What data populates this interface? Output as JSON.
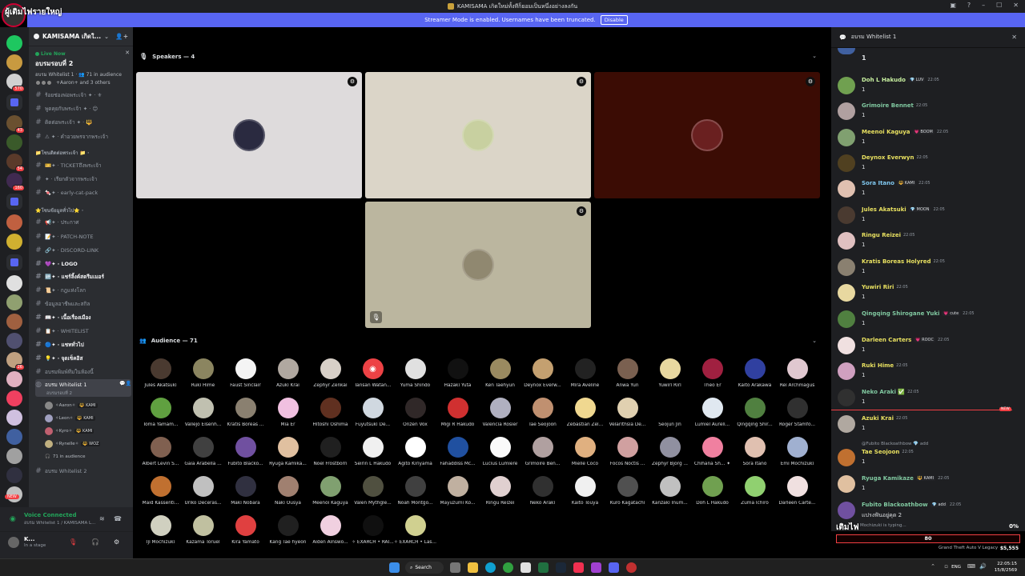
{
  "window": {
    "title": "KAMISAMA เกิดใหม่ทั้งทีก็ยอมเป็นหนึ่งอย่างลงกัน"
  },
  "overlay": {
    "title": "ผู้เติมไฟรายใหญ่",
    "bar_label": "เติมไฟ",
    "bar_percent": "0%",
    "bar_value": "80",
    "bar_fraction": 0.0
  },
  "streamer": {
    "text": "Streamer Mode is enabled. Usernames have been truncated.",
    "button": "Disable"
  },
  "server": {
    "name": "KAMISAMA เกิดใ...",
    "live_label": "Live Now",
    "stage_title": "อบรมรอบที่ 2",
    "stage_meta": "อบรม Whitelist 1 · 👥 71 in audience",
    "attendees": "+Aaron+ and 3 others"
  },
  "channels": [
    {
      "label": "ร้อยช่องพ่อพระเจ้า ✦ · ⚜",
      "kind": "channel"
    },
    {
      "label": "พูดคุยกับพระเจ้า ✦ · 😊",
      "kind": "channel"
    },
    {
      "label": "ติดต่อพระเจ้า ✦ · 🔱",
      "kind": "channel"
    },
    {
      "label": "⚠ ✦ · คำอวยพรจากพระเจ้า",
      "kind": "channel"
    },
    {
      "label": "📁โซนติดต่อพระเจ้า 📁 ·",
      "kind": "category"
    },
    {
      "label": "🎫✦ · TICKETถึงพระเจ้า",
      "kind": "channel"
    },
    {
      "label": "✦ · เรียกตัวจากพระเจ้า",
      "kind": "channel"
    },
    {
      "label": "🍬✦ · early-cat-pack",
      "kind": "channel"
    },
    {
      "label": "⭐โซนข้อมูลทั่วไป⭐ ·",
      "kind": "category"
    },
    {
      "label": "📢✦ · ประกาศ",
      "kind": "channel"
    },
    {
      "label": "📝✦ · PATCH-NOTE",
      "kind": "channel"
    },
    {
      "label": "🔗✦ · DISCORD-LINK",
      "kind": "channel"
    },
    {
      "label": "💜✦ · LOGO",
      "kind": "bold"
    },
    {
      "label": "🆙✦ · แชร์ลิ้งค์สตรีมเมอร์",
      "kind": "bold"
    },
    {
      "label": "📜✦ · กฎแห่งโลก",
      "kind": "channel"
    },
    {
      "label": "ข้อมูลอาชีพและสกิล",
      "kind": "channel"
    },
    {
      "label": "📖✦ · เนื้อเรื่องเมือง",
      "kind": "bold"
    },
    {
      "label": "📋✦ · WHITELIST",
      "kind": "channel"
    },
    {
      "label": "🔵✦ · แชททั่วไป",
      "kind": "bold"
    },
    {
      "label": "💡✦ · จุดเช็คอิส",
      "kind": "bold"
    },
    {
      "label": "อบรมพิมพ์ทีมในห้องนี้",
      "kind": "channel"
    },
    {
      "label": "อบรม Whitelist 1",
      "kind": "selected"
    },
    {
      "label": "อบรม Whitelist 2",
      "kind": "channel"
    }
  ],
  "selected_sub": "อบรมรอบที่ 2",
  "voice_users": [
    {
      "name": "✧Aaron✧",
      "tag": "KAMI"
    },
    {
      "name": "✧Leon✧",
      "tag": "KAMI"
    },
    {
      "name": "✧Kyro✧",
      "tag": "KAMI"
    },
    {
      "name": "✧Rynelle✧",
      "tag": "WOZ"
    }
  ],
  "voice_count": "71 in audience",
  "voice_panel": {
    "status": "Voice Connected",
    "channel": "อบรม Whitelist 1 / KAMISAMA L..."
  },
  "user": {
    "name": "K...",
    "status": "In a stage"
  },
  "new_pill": "NEW",
  "speakers": {
    "heading": "Speakers — 4"
  },
  "audience": {
    "heading": "Audience — 71",
    "names": [
      "Jules Akatsuki",
      "Ruki Hime",
      "Faust Sinclair",
      "Azuki Krai",
      "Zephyr Zenkai",
      "Tansan Watan...",
      "Yuma Shindo",
      "Hazaki Yuta",
      "Ken Taehyun",
      "Deynox Everw...",
      "Mira Aveline",
      "Anwa Yun",
      "Yuwiri Riri",
      "Theo Er",
      "Kaito Arakawa",
      "Rei Archmagus",
      "Toma Yamam...",
      "Vallejo Eisenh...",
      "Kratis Boreas ...",
      "Mia Er",
      "Hitoshi Oshima",
      "Fuyutsuki De...",
      "Onzen Vox",
      "Migi R Hakudo",
      "Valencia Rosier",
      "Tae Seojoon",
      "Zebastian Zel...",
      "Velarithsia De...",
      "Seojun Jin",
      "Lumiel Aureli...",
      "Qingqing Shir...",
      "Roger Stamfo...",
      "Albert Levin S...",
      "Gaia Arabella ...",
      "Fubito Blacko...",
      "Ryuga Kamika...",
      "Noel Frostborn",
      "Seirin L Hakudo",
      "Agito Kiriyama",
      "Fahaddiss Mc...",
      "Lucius Lumiere",
      "Grimoire Ben...",
      "Mielle Coco",
      "Focos Noctis ...",
      "Zephyr Bjorg ...",
      "Chihana Sh... ✦",
      "Sora Itano",
      "Emi Mochizuki",
      "Maid Kassenti...",
      "Uriko Deceras...",
      "Maki Nobara",
      "Naki Ousya",
      "Meenoi Kaguya",
      "Valen Mythgle...",
      "Noah Montgo...",
      "Mayuzumi Ko...",
      "Ringu Reizei",
      "Neko Araki",
      "Kaito Touya",
      "Kuro Kagatachi",
      "Kanzaki Inum...",
      "Doh L Hakudo",
      "Zuma Ichiro",
      "Darleen Carte...",
      "Iji Mochizuki",
      "Kazama Toruel",
      "Kira Yamato",
      "Kang Tae hyeon",
      "Aiden Ainswo...",
      "✧ EXARCH • RAI...",
      "✧ EXARCH • Las..."
    ],
    "colors": [
      "#4a3a30",
      "#8b8560",
      "#f4f4f4",
      "#b0a8a0",
      "#d8d0c8",
      "#ed4245",
      "#e0e0e0",
      "#111111",
      "#9a8a60",
      "#c4a070",
      "#222222",
      "#7a6050",
      "#e8d8a0",
      "#a02040",
      "#3040a0",
      "#e0c8d0",
      "#60a040",
      "#c0c0b0",
      "#8a8070",
      "#f0c0e0",
      "#603020",
      "#d0d8e0",
      "#302828",
      "#d03030",
      "#b0b0c0",
      "#c09070",
      "#f0d890",
      "#e0d0b0",
      "#000000",
      "#e0e8f0",
      "#508040",
      "#303030",
      "#806050",
      "#404040",
      "#7050a0",
      "#e0c0a0",
      "#202020",
      "#f0f0f0",
      "#ffffff",
      "#2050a0",
      "#fafafa",
      "#b0a0a0",
      "#e0b080",
      "#d0a0a0",
      "#9090a0",
      "#f080a0",
      "#e0c0b0",
      "#a0b0d0",
      "#c07030",
      "#c0c0c0",
      "#303040",
      "#a08070",
      "#80a070",
      "#505040",
      "#404040",
      "#c0b0a0",
      "#e0d0d0",
      "#303030",
      "#f0f0f0",
      "#505050",
      "#c0c0c0",
      "#70a050",
      "#90d070",
      "#f0e0e0",
      "#d0d0c0",
      "#c0c0a0",
      "#e04040",
      "#202020",
      "#f0d0e0",
      "#101010",
      "#d0d090"
    ]
  },
  "speaker_tiles": [
    {
      "bg": "#dedbdc",
      "av": "#2a2a40",
      "muted": false
    },
    {
      "bg": "#dbd5c8",
      "av": "#c8d0a0",
      "muted": false
    },
    {
      "bg": "#3b0c04",
      "av": "#6a2020",
      "muted": false
    },
    {
      "bg": "#bbb69f",
      "av": "#908870",
      "muted": true
    }
  ],
  "chat": {
    "title": "อบรม Whitelist 1",
    "top_text": "1",
    "messages": [
      {
        "name": "Doh L Hakudo",
        "color": "#c8f0a0",
        "badge": "💎 LUV",
        "time": "22:05",
        "text": "1",
        "av": "#70a050"
      },
      {
        "name": "Grimoire Bennet",
        "color": "#80c8a0",
        "badge": "",
        "time": "22:05",
        "text": "1",
        "av": "#b0a0a0"
      },
      {
        "name": "Meenoi Kaguya",
        "color": "#e8e060",
        "badge": "💗 BOOM",
        "time": "22:05",
        "text": "1",
        "av": "#80a070"
      },
      {
        "name": "Deynox Everwyn",
        "color": "#e8e060",
        "badge": "",
        "time": "22:05",
        "text": "1",
        "av": "#504020"
      },
      {
        "name": "Sora Itano",
        "color": "#80c8f0",
        "badge": "🔱 KAMI",
        "time": "22:05",
        "text": "1",
        "av": "#e0c0b0"
      },
      {
        "name": "Jules Akatsuki",
        "color": "#e8e060",
        "badge": "💎 MOON",
        "time": "22:05",
        "text": "1",
        "av": "#4a3a30"
      },
      {
        "name": "Ringu Reizei",
        "color": "#e8e060",
        "badge": "",
        "time": "22:05",
        "text": "1",
        "av": "#e0c0c0"
      },
      {
        "name": "Kratis Boreas Holyred",
        "color": "#e8e060",
        "badge": "",
        "time": "22:05",
        "text": "1",
        "av": "#8a8070"
      },
      {
        "name": "Yuwiri Riri",
        "color": "#e8e060",
        "badge": "",
        "time": "22:05",
        "text": "1",
        "av": "#e8d8a0"
      },
      {
        "name": "Qingqing Shirogane Yuki",
        "color": "#80c8a0",
        "badge": "💗 cute",
        "time": "22:05",
        "text": "1",
        "av": "#508040"
      },
      {
        "name": "Darleen Carters",
        "color": "#e8e060",
        "badge": "💗 ROOC",
        "time": "22:05",
        "text": "1",
        "av": "#f0e0e0"
      },
      {
        "name": "Ruki Hime",
        "color": "#e8e060",
        "badge": "",
        "time": "22:05",
        "text": "1",
        "av": "#d0a0c0"
      },
      {
        "name": "Neko Araki ✅",
        "color": "#80c8a0",
        "badge": "",
        "time": "22:05",
        "text": "1",
        "av": "#303030"
      },
      {
        "name": "Azuki Krai",
        "color": "#e8e060",
        "badge": "",
        "time": "22:05",
        "text": "1",
        "av": "#b0a8a0"
      },
      {
        "name": "Tae Seojoon",
        "color": "#e8e060",
        "badge": "",
        "time": "22:05",
        "text": "1",
        "av": "#c07030"
      },
      {
        "name": "Ryuga Kamikaze",
        "color": "#80c8a0",
        "badge": "🔱 KAMI",
        "time": "22:05",
        "text": "1",
        "av": "#e0c0a0"
      },
      {
        "name": "Fubito Blackoathbow",
        "color": "#80c8a0",
        "badge": "💎 add",
        "time": "22:05",
        "text": "แปรงฟันอยู่คุด 2",
        "av": "#7050a0"
      }
    ],
    "reply_ref": "@Fubito Blackoathbow 💎 add",
    "typing": "Mochizuki is typing...",
    "new_label": "NEW"
  },
  "game_info": {
    "title": "Grand Theft Auto V Legacy",
    "money": "$5,555"
  },
  "taskbar": {
    "search": "Search",
    "lang": "ENG",
    "time": "22:05:15",
    "date": "15/8/2569"
  }
}
